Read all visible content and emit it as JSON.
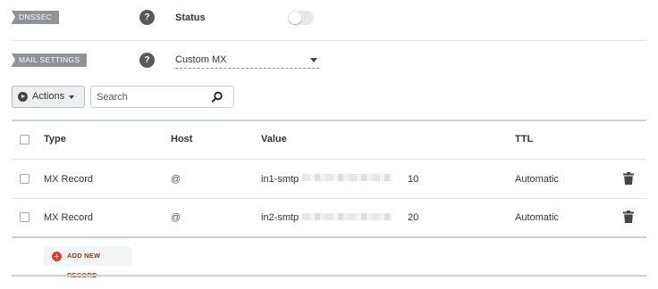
{
  "dnssec": {
    "tag_label": "DNSSEC",
    "help_glyph": "?",
    "status_label": "Status",
    "toggle_on": false
  },
  "mail_settings": {
    "tag_label": "MAIL SETTINGS",
    "help_glyph": "?",
    "selected_option": "Custom MX"
  },
  "toolbar": {
    "actions_label": "Actions",
    "search_placeholder": "Search"
  },
  "table": {
    "columns": [
      "Type",
      "Host",
      "Value",
      "TTL"
    ],
    "rows": [
      {
        "type": "MX Record",
        "host": "@",
        "value": "in1-smtp",
        "priority": "10",
        "ttl": "Automatic"
      },
      {
        "type": "MX Record",
        "host": "@",
        "value": "in2-smtp",
        "priority": "20",
        "ttl": "Automatic"
      }
    ]
  },
  "add_record_label": "ADD NEW RECORD",
  "colors": {
    "tag_bg": "#8f9397",
    "help_bg": "#555a5f",
    "accent_red": "#d9402c",
    "divider": "#c9d3d3"
  }
}
